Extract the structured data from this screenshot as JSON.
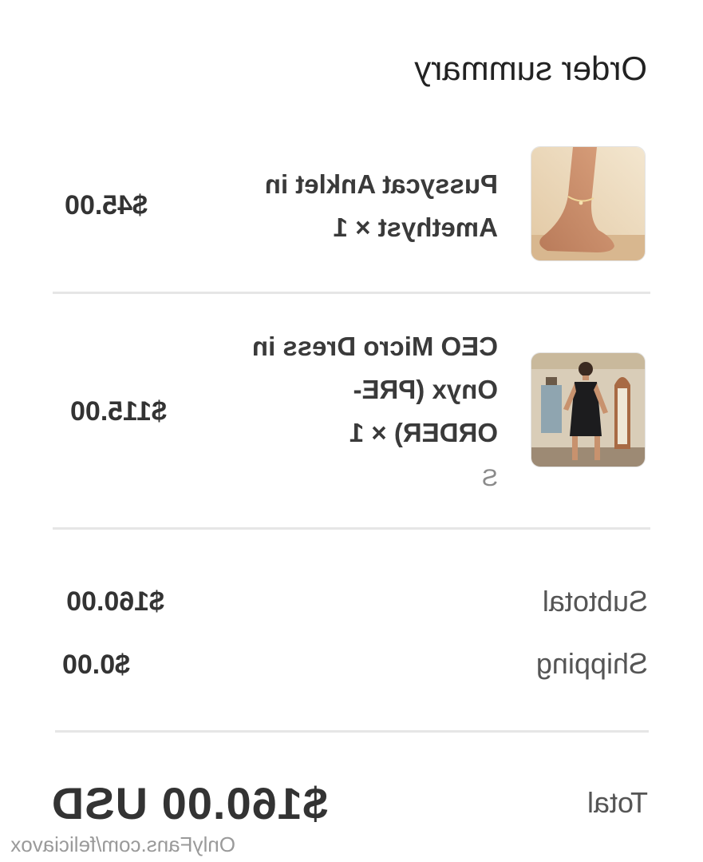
{
  "summary": {
    "title": "Order summary"
  },
  "items": [
    {
      "name_line1": "Pussycat Anklet in",
      "name_line2": "Amethyst × 1",
      "price": "$45.00",
      "image_icon": "anklet-product-image"
    },
    {
      "name_line1": "CEO Micro Dress in",
      "name_line2": "Onyx (PRE-",
      "name_line3": "ORDER) × 1",
      "variant": "S",
      "price": "$115.00",
      "image_icon": "dress-product-image"
    }
  ],
  "totals": {
    "subtotal_label": "Subtotal",
    "subtotal_value": "$160.00",
    "shipping_label": "Shipping",
    "shipping_value": "$0.00",
    "total_label": "Total",
    "total_value": "$160.00 USD"
  },
  "watermark": "OnlyFans.com/feliciavox",
  "colors": {
    "text": "#333333",
    "muted": "#8a8a8a",
    "divider": "#e6e6e6"
  }
}
